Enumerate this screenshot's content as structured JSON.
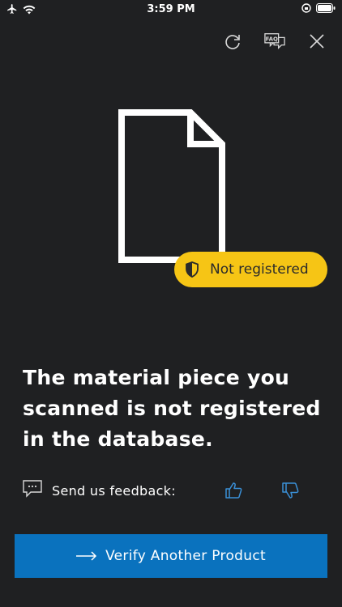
{
  "status_bar": {
    "time": "3:59 PM",
    "left_icons": [
      "airplane-icon",
      "wifi-icon"
    ],
    "right_icons": [
      "orientation-lock-icon",
      "battery-icon"
    ]
  },
  "top_actions": [
    "refresh-icon",
    "faq-icon",
    "close-icon"
  ],
  "faq_icon_text": "FAQ",
  "status_badge": {
    "label": "Not registered",
    "color": "#f6c515"
  },
  "headline": "The material piece you scanned is not registered in the database.",
  "feedback": {
    "label": "Send us feedback:",
    "icons": [
      "chat-icon",
      "thumbs-up-icon",
      "thumbs-down-icon"
    ]
  },
  "primary_button": {
    "label": "Verify Another Product",
    "color": "#0a72be"
  },
  "colors": {
    "background": "#1f2022",
    "accent_blue": "#0a72be",
    "feedback_icon_blue": "#3a8fd6"
  }
}
